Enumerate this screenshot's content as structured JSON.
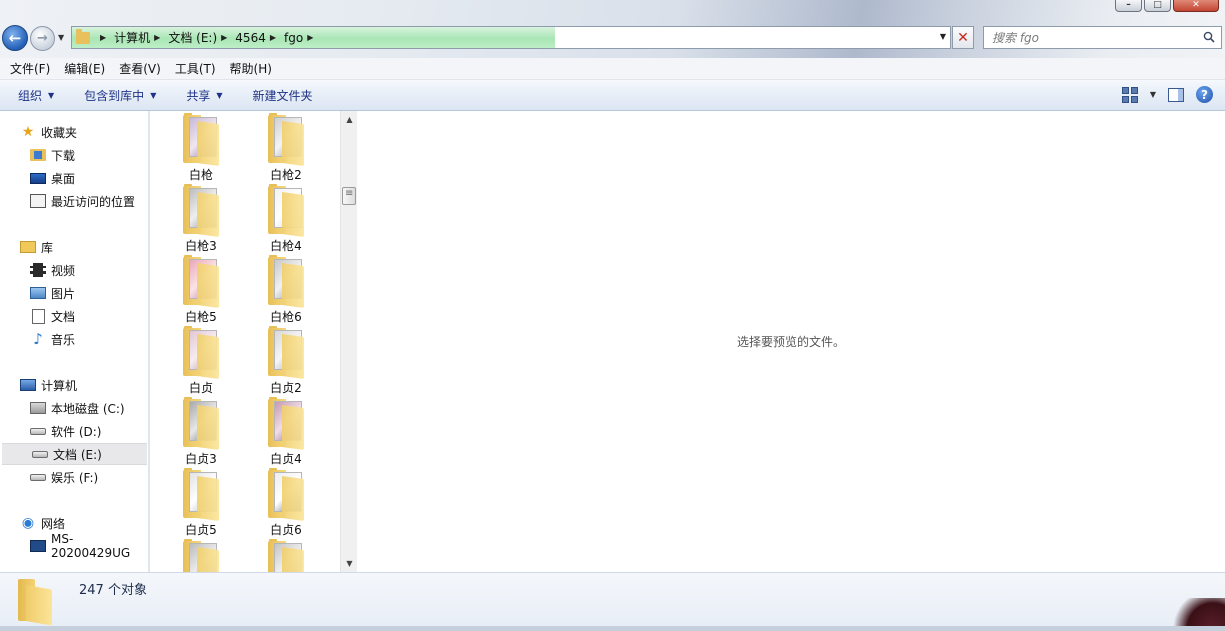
{
  "window": {
    "controls": {
      "minimize": "–",
      "maximize": "□",
      "close": "✕"
    }
  },
  "address_bar": {
    "crumbs": [
      "计算机",
      "文档 (E:)",
      "4564",
      "fgo"
    ],
    "loading_progress": 0.55
  },
  "search": {
    "placeholder": "搜索 fgo"
  },
  "menu": [
    "文件(F)",
    "编辑(E)",
    "查看(V)",
    "工具(T)",
    "帮助(H)"
  ],
  "toolbar": {
    "organize": "组织",
    "include_in_library": "包含到库中",
    "share": "共享",
    "new_folder": "新建文件夹"
  },
  "nav": {
    "favorites": {
      "label": "收藏夹",
      "items": [
        "下载",
        "桌面",
        "最近访问的位置"
      ]
    },
    "libraries": {
      "label": "库",
      "items": [
        "视频",
        "图片",
        "文档",
        "音乐"
      ]
    },
    "computer": {
      "label": "计算机",
      "items": [
        "本地磁盘 (C:)",
        "软件 (D:)",
        "文档 (E:)",
        "娱乐 (F:)"
      ],
      "selected": "文档 (E:)"
    },
    "network": {
      "label": "网络",
      "items": [
        "MS-20200429UG"
      ]
    }
  },
  "files": [
    "白枪",
    "白枪2",
    "白枪3",
    "白枪4",
    "白枪5",
    "白枪6",
    "白贞",
    "白贞2",
    "白贞3",
    "白贞4",
    "白贞5",
    "白贞6"
  ],
  "preview": {
    "message": "选择要预览的文件。"
  },
  "details": {
    "count": "247 个对象"
  },
  "icons": {
    "back": "arrow-left-icon",
    "forward": "arrow-right-icon",
    "search": "magnifier-icon",
    "help": "question-icon"
  },
  "colors": {
    "command_text": "#1e3287",
    "folder": "#e8c15d",
    "progress": "#a9e6b5"
  }
}
